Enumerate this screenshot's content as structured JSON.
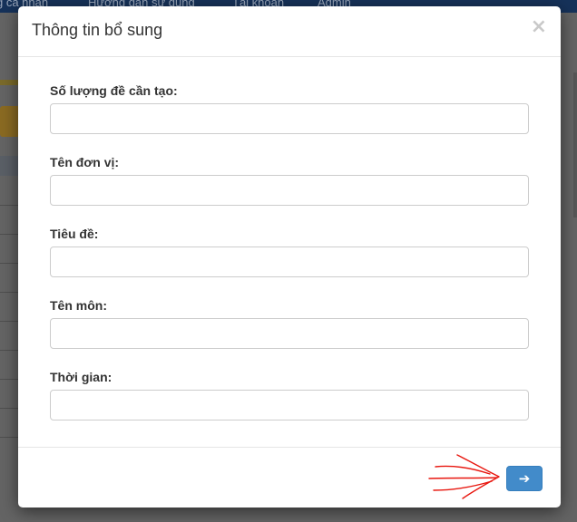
{
  "background": {
    "nav_items": [
      "g cá nhân",
      "Hướng dẫn sử dụng",
      "Tài khoản",
      "Admin"
    ]
  },
  "modal": {
    "title": "Thông tin bổ sung",
    "close_label": "×",
    "fields": [
      {
        "label": "Số lượng đề cần tạo:",
        "value": ""
      },
      {
        "label": "Tên đơn vị:",
        "value": ""
      },
      {
        "label": "Tiêu đề:",
        "value": ""
      },
      {
        "label": "Tên môn:",
        "value": ""
      },
      {
        "label": "Thời gian:",
        "value": ""
      }
    ],
    "submit_icon": "arrow-right-icon",
    "submit_glyph": "➔"
  },
  "colors": {
    "primary": "#428bca",
    "annotation": "#e8170f"
  }
}
